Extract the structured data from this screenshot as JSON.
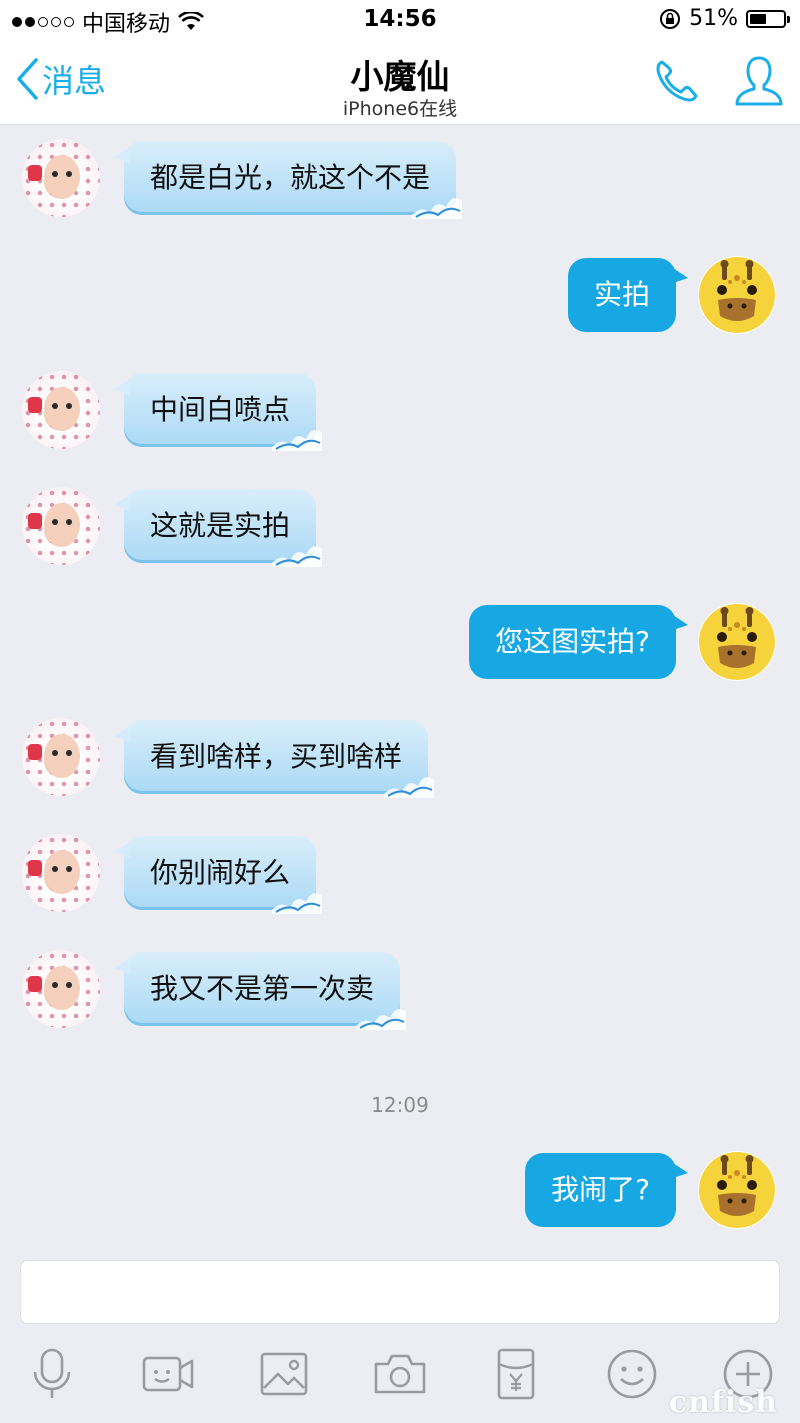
{
  "status_bar": {
    "carrier": "中国移动",
    "time": "14:56",
    "battery_percent": "51%",
    "battery_level": 0.51
  },
  "nav": {
    "back_label": "消息",
    "title": "小魔仙",
    "subtitle": "iPhone6在线",
    "icons": [
      "phone-icon",
      "profile-icon"
    ]
  },
  "messages": [
    {
      "sender": "friend",
      "text": "都是白光，就这个不是"
    },
    {
      "sender": "me",
      "text": "实拍"
    },
    {
      "sender": "friend",
      "text": "中间白喷点"
    },
    {
      "sender": "friend",
      "text": "这就是实拍"
    },
    {
      "sender": "me",
      "text": "您这图实拍?"
    },
    {
      "sender": "friend",
      "text": "看到啥样，买到啥样"
    },
    {
      "sender": "friend",
      "text": "你别闹好么"
    },
    {
      "sender": "friend",
      "text": "我又不是第一次卖"
    },
    {
      "sender": "me",
      "text": "我闹了?"
    }
  ],
  "timestamp": "12:09",
  "input": {
    "placeholder": ""
  },
  "toolbar": [
    "microphone-icon",
    "video-icon",
    "image-icon",
    "camera-icon",
    "red-packet-icon",
    "emoji-icon",
    "plus-icon"
  ],
  "watermark": "cnfish",
  "colors": {
    "accent": "#1aaee9",
    "my_bubble": "#17a8e4",
    "friend_bubble": "#aad9f6",
    "background": "#ebedf2"
  }
}
